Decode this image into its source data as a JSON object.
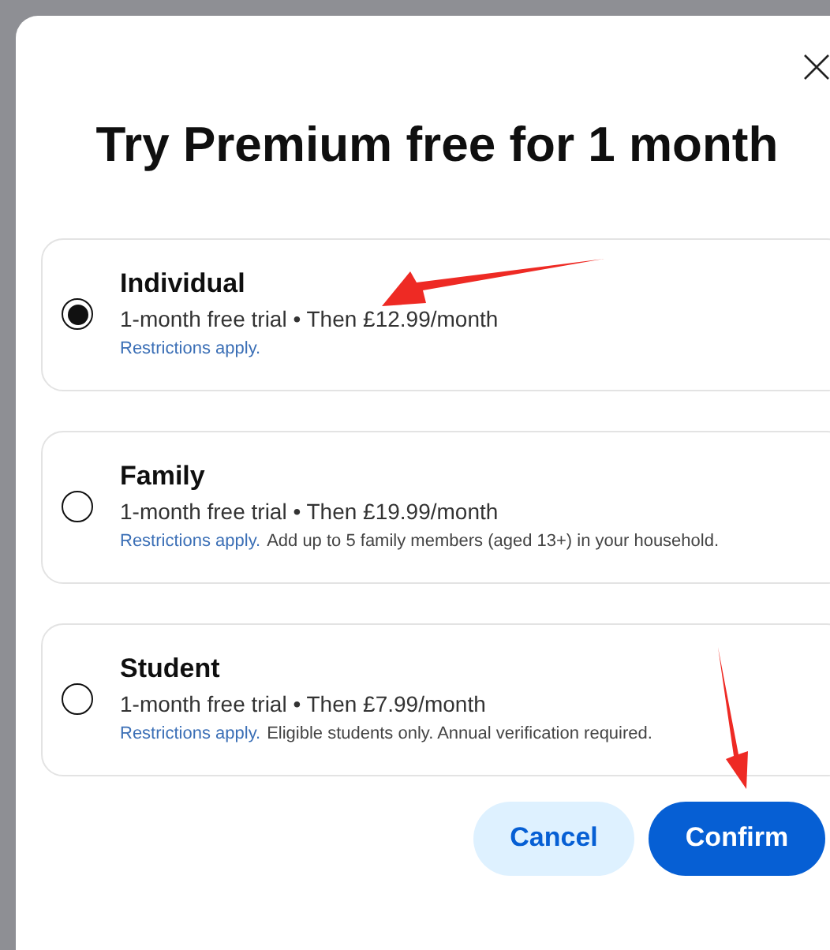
{
  "dialog": {
    "title": "Try Premium free for 1 month",
    "plans": [
      {
        "name": "Individual",
        "selected": true,
        "price": "1-month free trial • Then £12.99/month",
        "restrictions": "Restrictions apply."
      },
      {
        "name": "Family",
        "selected": false,
        "price": "1-month free trial • Then £19.99/month",
        "restrictions": "Restrictions apply.",
        "note": "Add up to 5 family members (aged 13+) in your household."
      },
      {
        "name": "Student",
        "selected": false,
        "price": "1-month free trial • Then £7.99/month",
        "restrictions": "Restrictions apply.",
        "note": "Eligible students only. Annual verification required."
      }
    ],
    "buttons": [
      {
        "label": "Cancel",
        "kind": "secondary"
      },
      {
        "label": "Confirm",
        "kind": "primary"
      }
    ]
  }
}
